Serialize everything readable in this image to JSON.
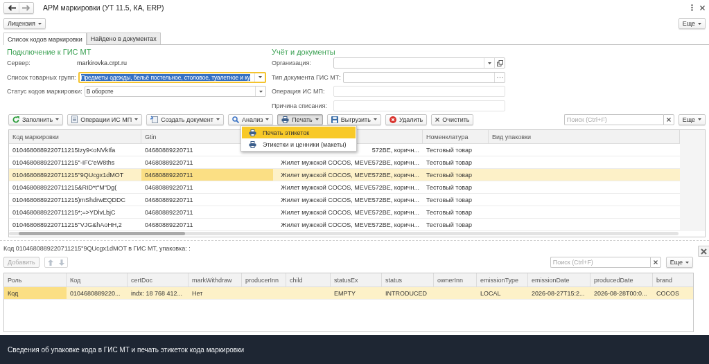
{
  "window": {
    "title": "АРМ маркировки (УТ 11.5, КА, ERP)"
  },
  "command_bar": {
    "license_button": "Лицензия",
    "more_button": "Еще"
  },
  "tabs": [
    {
      "label": "Список кодов маркировки",
      "selected": true
    },
    {
      "label": "Найдено в документах",
      "selected": false
    }
  ],
  "connection": {
    "heading": "Подключение к ГИС МТ",
    "fields": [
      {
        "kind": "text",
        "label": "Сервер:",
        "value": "markirovka.crpt.ru"
      },
      {
        "kind": "dropdown",
        "label": "Список товарных групп:",
        "value": "Предметы одежды, бельё постельное, столовое, туалетное и ку",
        "focused": true
      },
      {
        "kind": "dropdown",
        "label": "Статус кодов маркировки:",
        "value": "В обороте",
        "focused": false
      }
    ]
  },
  "accounting": {
    "heading": "Учёт и документы",
    "fields": [
      {
        "kind": "dropdown_open",
        "label": "Организация:"
      },
      {
        "kind": "choice",
        "label": "Тип документа ГИС МТ:"
      },
      {
        "kind": "input",
        "label": "Операция ИС МП:"
      },
      {
        "kind": "input",
        "label": "Причина списания:"
      }
    ]
  },
  "toolbar": {
    "buttons": [
      {
        "label": "Заполнить",
        "dropdown": true,
        "pressed": false
      },
      {
        "label": "Операции ИС МП",
        "dropdown": true,
        "pressed": false
      },
      {
        "label": "Создать документ",
        "dropdown": true,
        "pressed": false
      },
      {
        "label": "Анализ",
        "dropdown": true,
        "pressed": false
      },
      {
        "label": "Печать",
        "dropdown": true,
        "pressed": true
      },
      {
        "label": "Выгрузить",
        "dropdown": true,
        "pressed": false
      },
      {
        "label": "Удалить",
        "dropdown": false,
        "pressed": false
      },
      {
        "label": "Очистить",
        "dropdown": false,
        "pressed": false
      }
    ],
    "search": {
      "placeholder": "Поиск (Ctrl+F)"
    },
    "more_button": "Еще"
  },
  "print_menu": {
    "items": [
      {
        "label": "Печать этикеток",
        "selected": true
      },
      {
        "label": "Этикетки и ценники (макеты)",
        "selected": false
      }
    ]
  },
  "codes_table": {
    "columns": [
      {
        "label": "Код маркировки",
        "current": false
      },
      {
        "label": "Gtin",
        "current": true
      },
      {
        "current": false
      },
      {
        "label": "Номенклатура",
        "current": false
      },
      {
        "label": "Вид упаковки",
        "current": false
      }
    ],
    "rows": [
      {
        "cells": [
          "0104680889220711215Izy9<oNVkIfa",
          "04680889220711",
          "572BE, коричн...",
          "Тестовый товар"
        ],
        "selected": false
      },
      {
        "cells": [
          "0104680889220711215\"-IFC'eW8ths",
          "04680889220711",
          "Жилет мужской COCOS, MEVE572BE, коричн...",
          "Тестовый товар"
        ],
        "selected": false
      },
      {
        "cells": [
          "0104680889220711215\"9QUcgx1dMOT",
          "04680889220711",
          "Жилет мужской COCOS, MEVE572BE, коричн...",
          "Тестовый товар"
        ],
        "selected": true
      },
      {
        "cells": [
          "0104680889220711215&RID*t\"M\"Dg(",
          "04680889220711",
          "Жилет мужской COCOS, MEVE572BE, коричн...",
          "Тестовый товар"
        ],
        "selected": false
      },
      {
        "cells": [
          "0104680889220711215)mShdrwEQDDC",
          "04680889220711",
          "Жилет мужской COCOS, MEVE572BE, коричн...",
          "Тестовый товар"
        ],
        "selected": false
      },
      {
        "cells": [
          "0104680889220711215*;=>YDlvLbjC",
          "04680889220711",
          "Жилет мужской COCOS, MEVE572BE, коричн...",
          "Тестовый товар"
        ],
        "selected": false
      },
      {
        "cells": [
          "0104680889220711215\"VJG&hAoHH,2",
          "04680889220711",
          "Жилет мужской COCOS, MEVE572BE, коричн...",
          "Тестовый товар"
        ],
        "selected": false
      }
    ]
  },
  "details": {
    "caption": "Код 0104680889220711215\"9QUcgx1dMOT в ГИС МТ, упаковка: :",
    "add_button": {
      "label": "Добавить",
      "disabled": true
    },
    "search": {
      "placeholder": "Поиск (Ctrl+F)"
    },
    "more_button": "Еще",
    "table": {
      "columns": [
        {
          "label": "Роль",
          "current": true
        },
        {
          "label": "Код",
          "current": false
        },
        {
          "label": "certDoc",
          "current": false
        },
        {
          "label": "markWithdraw",
          "current": false
        },
        {
          "label": "producerInn",
          "current": false
        },
        {
          "label": "child",
          "current": false
        },
        {
          "label": "statusEx",
          "current": false
        },
        {
          "label": "status",
          "current": false
        },
        {
          "label": "ownerInn",
          "current": false
        },
        {
          "label": "emissionType",
          "current": false
        },
        {
          "label": "emissionDate",
          "current": false
        },
        {
          "label": "producedDate",
          "current": false
        },
        {
          "label": "brand",
          "current": false
        }
      ],
      "rows": [
        {
          "cells": [
            "Код",
            "0104680889220...",
            "indx: 18 768 412...",
            "Нет",
            "",
            "",
            "EMPTY",
            "INTRODUCED",
            "",
            "LOCAL",
            "2026-08-27T15:2...",
            "2026-08-28T00:0...",
            "COCOS"
          ],
          "selected": true
        }
      ]
    }
  },
  "caption_banner": {
    "text": "Сведения об упаковке кода в ГИС МТ и печать этикеток кода маркировки"
  }
}
